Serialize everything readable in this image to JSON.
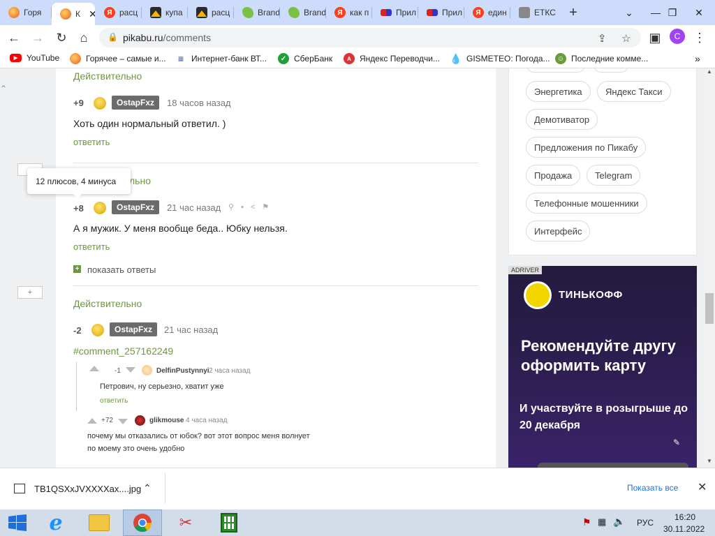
{
  "tabs": [
    {
      "label": "Горя",
      "icon": "pikabu-icon"
    },
    {
      "label": "К",
      "icon": "pikabu-icon",
      "active": true
    },
    {
      "label": "расц",
      "icon": "yandex-icon"
    },
    {
      "label": "купа",
      "icon": "image-icon"
    },
    {
      "label": "расц",
      "icon": "image-icon"
    },
    {
      "label": "Brand",
      "icon": "brand-icon"
    },
    {
      "label": "Brand",
      "icon": "brand-icon"
    },
    {
      "label": "как п",
      "icon": "yandex-icon"
    },
    {
      "label": "Прил",
      "icon": "mail-icon"
    },
    {
      "label": "Прил",
      "icon": "mail-icon"
    },
    {
      "label": "един",
      "icon": "yandex-icon"
    },
    {
      "label": "ЕТКС",
      "icon": "etks-icon"
    }
  ],
  "omnibox": {
    "host": "pikabu.ru",
    "path": "/comments"
  },
  "profile_initial": "C",
  "bookmarks": [
    {
      "label": "YouTube"
    },
    {
      "label": "Горячее – самые и..."
    },
    {
      "label": "Интернет-банк ВТ..."
    },
    {
      "label": "СберБанк"
    },
    {
      "label": "Яндекс Переводчи..."
    },
    {
      "label": "GISMETEO: Погода..."
    },
    {
      "label": "Последние комме..."
    }
  ],
  "comments": {
    "c1": {
      "title": "Действительно",
      "rating": "+9",
      "nick": "OstapFxz",
      "time": "18 часов назад",
      "text": "Хоть один нормальный ответил. )",
      "reply": "ответить"
    },
    "c2": {
      "title_fragment": "льно",
      "rating": "+8",
      "nick": "OstapFxz",
      "time": "21 час назад",
      "text": "А я мужик. У меня вообще беда.. Юбку нельзя.",
      "reply": "ответить",
      "show_replies": "показать ответы"
    },
    "c3": {
      "title": "Действительно",
      "rating": "-2",
      "nick": "OstapFxz",
      "time": "21 час назад",
      "link": "#comment_257162249"
    },
    "n1": {
      "rating": "-1",
      "nick": "DelfinPustynnyi",
      "time": "2 часа назад",
      "text": "Петрович, ну серьезно, хватит уже",
      "reply": "ответить"
    },
    "n2": {
      "rating": "+72",
      "nick": "glikmouse",
      "time": "4 часа назад",
      "text1": "почему мы отказались от юбок? вот этот вопрос меня волнует",
      "text2": "по моему это очень удобно"
    }
  },
  "collapse_plus": "+",
  "tooltip": "12 плюсов, 4 минуса",
  "tags": [
    "Энергетика",
    "Яндекс Такси",
    "Демотиватор",
    "Предложения по Пикабу",
    "Продажа",
    "Telegram",
    "Телефонные мошенники",
    "Интерфейс"
  ],
  "ad": {
    "label": "ADRIVER",
    "brand": "ТИНЬКОФФ",
    "headline": "Рекомендуйте другу оформить карту",
    "sub": "И участвуйте в розыгрыше до 20 декабря"
  },
  "download": {
    "file": "TB1QSXxJVXXXXax....jpg",
    "show_all": "Показать все"
  },
  "taskbar": {
    "lang": "РУС",
    "time": "16:20",
    "date": "30.11.2022"
  }
}
